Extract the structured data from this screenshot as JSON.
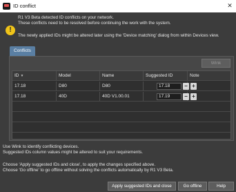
{
  "window": {
    "title": "ID conflict",
    "close_glyph": "✕"
  },
  "messages": {
    "line1": "R1 V3 Beta detected ID conflicts on your network.",
    "line2": "These conflicts need to be resolved before continuing the work with the system.",
    "line3": "The newly applied IDs might be altered later using the 'Device matching' dialog from within Devices view."
  },
  "tabs": [
    {
      "label": "Conflicts"
    }
  ],
  "toolbar": {
    "wink_label": "Wink"
  },
  "table": {
    "columns": [
      "ID",
      "Model",
      "Name",
      "Suggested ID",
      "Note"
    ],
    "sort_indicator": "▼",
    "rows": [
      {
        "id": "17.18",
        "model": "D80",
        "name": "D80",
        "suggested_id": "17.18",
        "note": ""
      },
      {
        "id": "17.18",
        "model": "40D",
        "name": "40D V1.00.01",
        "suggested_id": "17.19",
        "note": ""
      }
    ]
  },
  "footer": {
    "line1": "Use Wink to identify conflicting devices.",
    "line2": "Suggested IDs column values might be altered to suit your requirements.",
    "line3": "Choose 'Apply suggested IDs and close', to apply the changes specified above.",
    "line4": "Choose 'Go offline' to go offline without solving the conflicts automatically by R1 V3 Beta."
  },
  "buttons": {
    "apply": "Apply suggested IDs and close",
    "offline": "Go offline",
    "help": "Help"
  },
  "colors": {
    "background": "#3c3c3c",
    "tab_active": "#5a7fa3",
    "warning": "#f0c419"
  }
}
